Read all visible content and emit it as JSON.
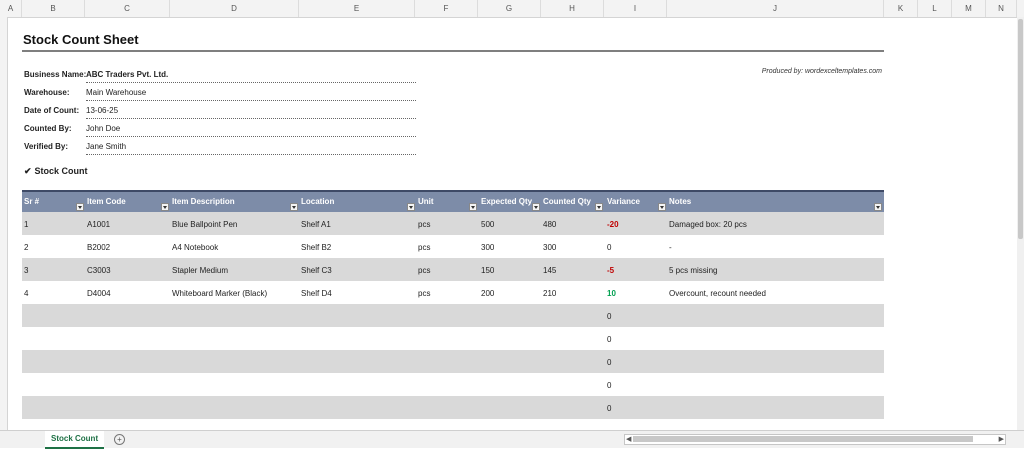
{
  "columns": [
    "A",
    "B",
    "C",
    "D",
    "E",
    "F",
    "G",
    "H",
    "I",
    "J",
    "K",
    "L",
    "M",
    "N"
  ],
  "title": "Stock Count Sheet",
  "produced_by": "Produced by: wordexceltemplates.com",
  "info": [
    {
      "label": "Business Name:",
      "value": "ABC Traders Pvt. Ltd."
    },
    {
      "label": "Warehouse:",
      "value": "Main Warehouse"
    },
    {
      "label": "Date of Count:",
      "value": "13-06-25"
    },
    {
      "label": "Counted By:",
      "value": "John Doe"
    },
    {
      "label": "Verified By:",
      "value": "Jane Smith"
    }
  ],
  "section_title": "Stock Count",
  "table": {
    "headers": [
      "Sr #",
      "Item Code",
      "Item Description",
      "Location",
      "Unit",
      "Expected Qty",
      "Counted Qty",
      "Variance",
      "Notes"
    ],
    "rows": [
      [
        "1",
        "A1001",
        "Blue Ballpoint Pen",
        "Shelf A1",
        "pcs",
        "500",
        "480",
        "-20",
        "Damaged box: 20 pcs"
      ],
      [
        "2",
        "B2002",
        "A4 Notebook",
        "Shelf B2",
        "pcs",
        "300",
        "300",
        "0",
        "-"
      ],
      [
        "3",
        "C3003",
        "Stapler Medium",
        "Shelf C3",
        "pcs",
        "150",
        "145",
        "-5",
        "5 pcs missing"
      ],
      [
        "4",
        "D4004",
        "Whiteboard Marker (Black)",
        "Shelf D4",
        "pcs",
        "200",
        "210",
        "10",
        "Overcount, recount needed"
      ],
      [
        "",
        "",
        "",
        "",
        "",
        "",
        "",
        "0",
        ""
      ],
      [
        "",
        "",
        "",
        "",
        "",
        "",
        "",
        "0",
        ""
      ],
      [
        "",
        "",
        "",
        "",
        "",
        "",
        "",
        "0",
        ""
      ],
      [
        "",
        "",
        "",
        "",
        "",
        "",
        "",
        "0",
        ""
      ],
      [
        "",
        "",
        "",
        "",
        "",
        "",
        "",
        "0",
        ""
      ]
    ]
  },
  "sheet_tab": "Stock Count",
  "add_sheet": "+",
  "scroll_left": "◀",
  "scroll_right": "▶",
  "colors": {
    "header_bg": "#7d8ca8",
    "negative": "#c00000",
    "positive": "#00a050",
    "tab_accent": "#1e7145"
  }
}
